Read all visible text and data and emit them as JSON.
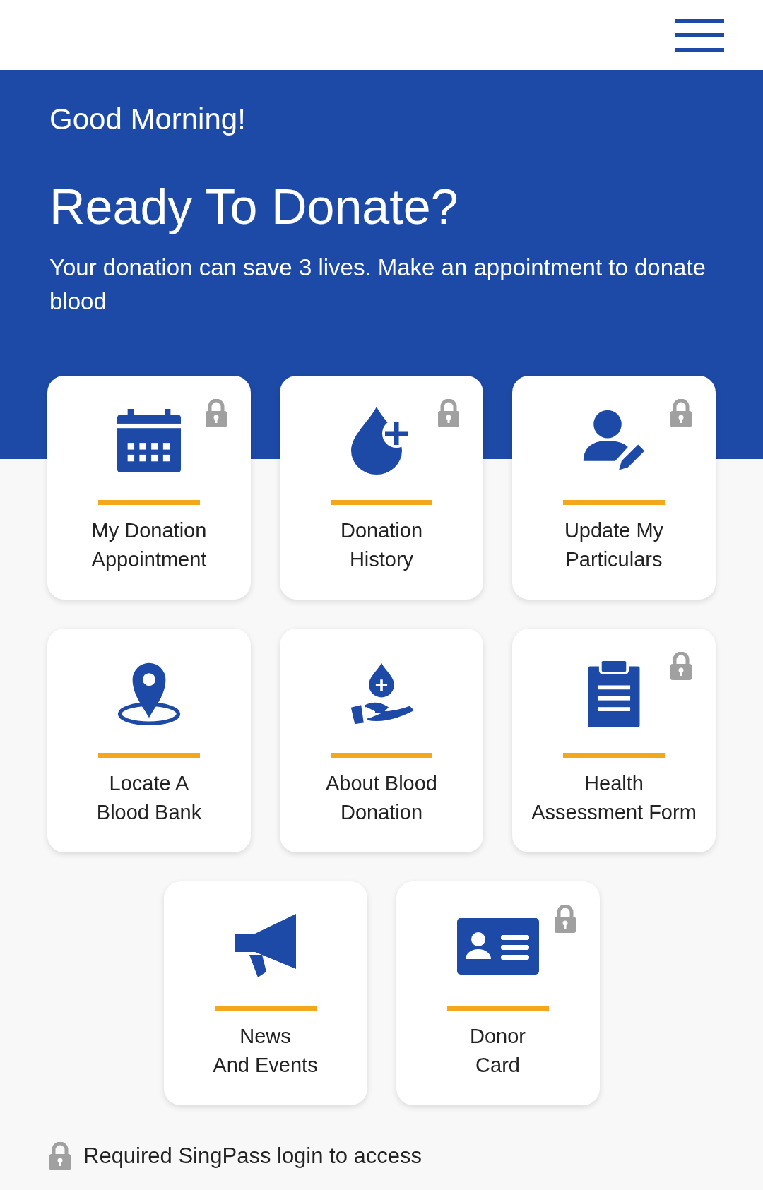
{
  "banner": {
    "greeting": "Good Morning!",
    "title": "Ready To Donate?",
    "subtitle": "Your donation can save 3 lives. Make an appointment to donate blood"
  },
  "tiles": [
    {
      "lines": [
        "My Donation",
        "Appointment"
      ],
      "locked": true
    },
    {
      "lines": [
        "Donation",
        "History"
      ],
      "locked": true
    },
    {
      "lines": [
        "Update My",
        "Particulars"
      ],
      "locked": true
    },
    {
      "lines": [
        "Locate A",
        "Blood Bank"
      ],
      "locked": false
    },
    {
      "lines": [
        "About Blood",
        "Donation"
      ],
      "locked": false
    },
    {
      "lines": [
        "Health",
        "Assessment Form"
      ],
      "locked": true
    },
    {
      "lines": [
        "News",
        "And Events"
      ],
      "locked": false
    },
    {
      "lines": [
        "Donor",
        "Card"
      ],
      "locked": true
    }
  ],
  "footer": {
    "note": "Required SingPass login to access"
  }
}
